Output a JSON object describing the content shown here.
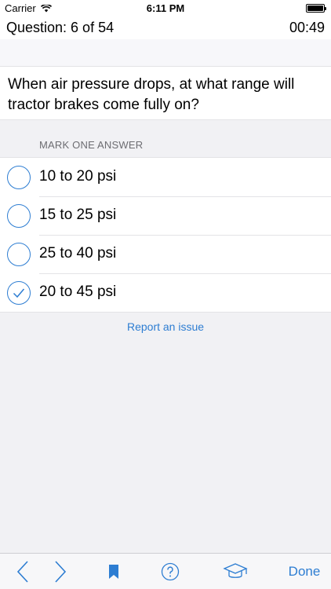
{
  "status_bar": {
    "carrier": "Carrier",
    "time": "6:11 PM"
  },
  "header": {
    "question_counter": "Question: 6 of 54",
    "timer": "00:49"
  },
  "question": {
    "text": "When air pressure drops, at what range will tractor brakes come fully on?"
  },
  "answers_section": {
    "header": "MARK ONE ANSWER"
  },
  "answers": [
    {
      "label": "10 to 20 psi",
      "selected": false
    },
    {
      "label": "15 to 25 psi",
      "selected": false
    },
    {
      "label": "25 to 40 psi",
      "selected": false
    },
    {
      "label": "20 to 45 psi",
      "selected": true
    }
  ],
  "report_link": "Report an issue",
  "toolbar": {
    "done_label": "Done"
  },
  "icons": {
    "back": "chevron-left-icon",
    "forward": "chevron-right-icon",
    "bookmark": "bookmark-icon",
    "help": "question-circle-icon",
    "study": "graduation-cap-icon"
  },
  "colors": {
    "accent": "#2d7dd2",
    "background": "#f1f1f4"
  }
}
